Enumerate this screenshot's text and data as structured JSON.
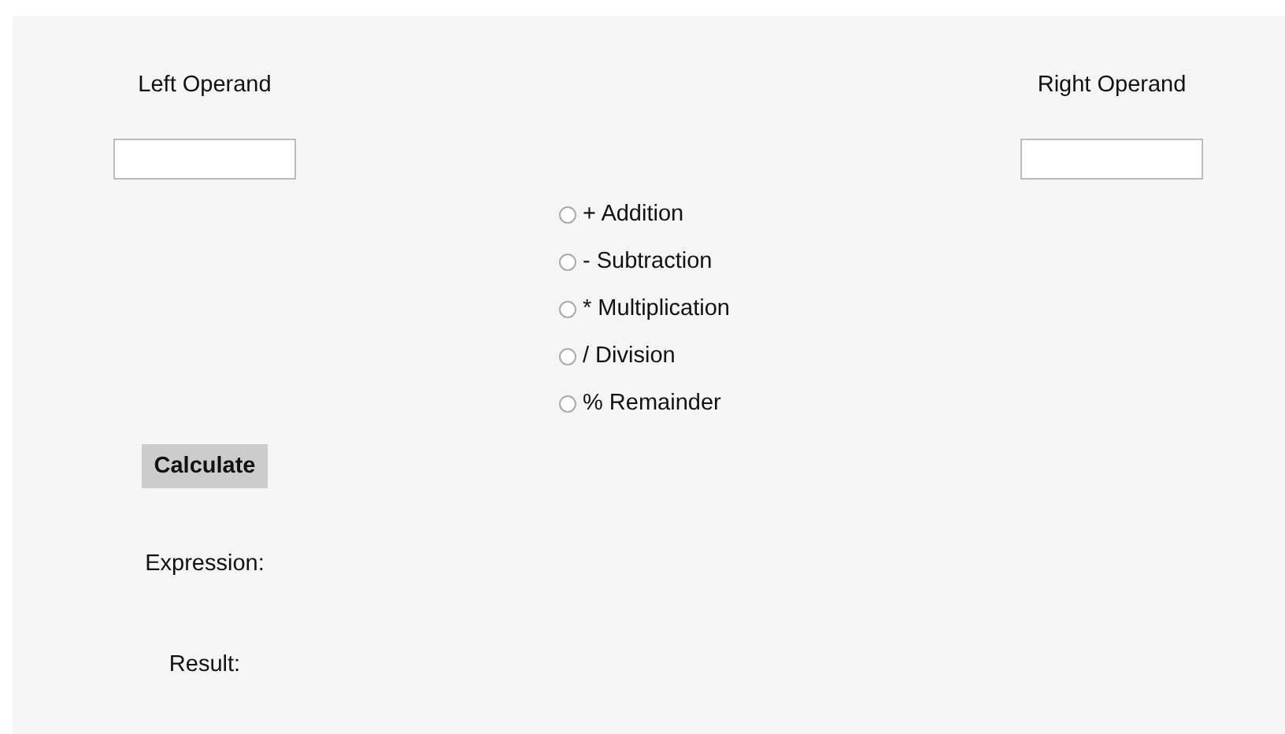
{
  "left_operand": {
    "label": "Left Operand"
  },
  "right_operand": {
    "label": "Right Operand"
  },
  "operations": [
    {
      "label": "+ Addition",
      "selected": false
    },
    {
      "label": "- Subtraction",
      "selected": false
    },
    {
      "label": "* Multiplication",
      "selected": false
    },
    {
      "label": "/ Division",
      "selected": false
    },
    {
      "label": "% Remainder",
      "selected": false
    }
  ],
  "calculate_button": "Calculate",
  "expression_label": "Expression:",
  "result_label": "Result:"
}
